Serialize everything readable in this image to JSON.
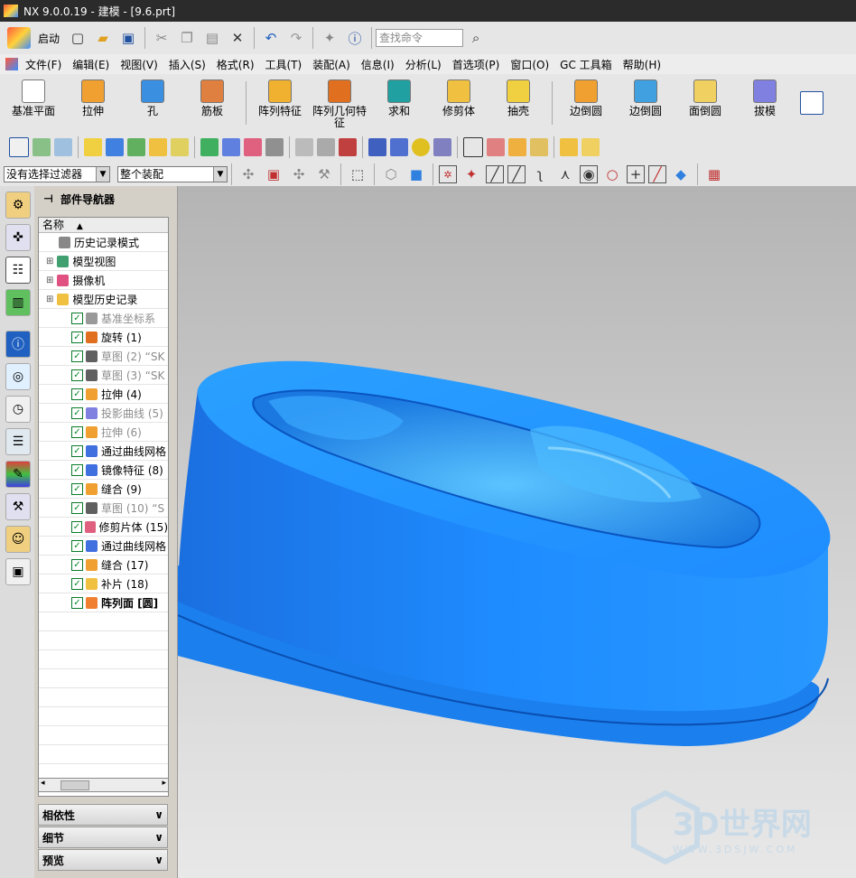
{
  "window": {
    "title": "NX 9.0.0.19 - 建模 - [9.6.prt]"
  },
  "toolbar_top": {
    "start_label": "启动",
    "search_placeholder": "查找命令"
  },
  "menubar": [
    "文件(F)",
    "编辑(E)",
    "视图(V)",
    "插入(S)",
    "格式(R)",
    "工具(T)",
    "装配(A)",
    "信息(I)",
    "分析(L)",
    "首选项(P)",
    "窗口(O)",
    "GC 工具箱",
    "帮助(H)"
  ],
  "feature_toolbar": [
    {
      "label": "基准平面",
      "icon": "datum-plane-icon",
      "color": "#ffffff"
    },
    {
      "label": "拉伸",
      "icon": "extrude-icon",
      "color": "#f0a030"
    },
    {
      "label": "孔",
      "icon": "hole-icon",
      "color": "#3b8fe0"
    },
    {
      "label": "筋板",
      "icon": "rib-icon",
      "color": "#e08040"
    },
    {
      "label": "阵列特征",
      "icon": "pattern-feature-icon",
      "color": "#f0b030"
    },
    {
      "label": "阵列几何特征",
      "icon": "pattern-geometry-icon",
      "color": "#e07020"
    },
    {
      "label": "求和",
      "icon": "unite-icon",
      "color": "#20a0a0"
    },
    {
      "label": "修剪体",
      "icon": "trim-body-icon",
      "color": "#f0c040"
    },
    {
      "label": "抽壳",
      "icon": "shell-icon",
      "color": "#f0d040"
    },
    {
      "label": "边倒圆",
      "icon": "edge-blend-icon",
      "color": "#f0a030"
    },
    {
      "label": "边倒圆",
      "icon": "edge-blend-2-icon",
      "color": "#40a0e0"
    },
    {
      "label": "面倒圆",
      "icon": "face-blend-icon",
      "color": "#f0d060"
    },
    {
      "label": "拔模",
      "icon": "draft-icon",
      "color": "#8080e0"
    }
  ],
  "selection_bar": {
    "filter": "没有选择过滤器",
    "scope": "整个装配"
  },
  "navigator": {
    "title": "部件导航器",
    "column_header": "名称",
    "items": [
      {
        "label": "历史记录模式",
        "icon": "clock-icon",
        "state": "normal",
        "checkbox": false,
        "indent": 1,
        "color": "#888888"
      },
      {
        "label": "模型视图",
        "icon": "model-views-icon",
        "state": "normal",
        "checkbox": false,
        "indent": 0,
        "color": "#40a070"
      },
      {
        "label": "摄像机",
        "icon": "camera-icon",
        "state": "normal",
        "checkbox": false,
        "indent": 0,
        "color": "#e05080"
      },
      {
        "label": "模型历史记录",
        "icon": "folder-icon",
        "state": "normal",
        "checkbox": false,
        "indent": 0,
        "color": "#f0c040"
      },
      {
        "label": "基准坐标系",
        "icon": "datum-csys-icon",
        "state": "dim",
        "checkbox": true,
        "indent": 2,
        "color": "#999999"
      },
      {
        "label": "旋转 (1)",
        "icon": "revolve-icon",
        "state": "normal",
        "checkbox": true,
        "indent": 2,
        "color": "#e07020"
      },
      {
        "label": "草图 (2) “SK",
        "icon": "sketch-icon",
        "state": "dim",
        "checkbox": true,
        "indent": 2,
        "color": "#606060"
      },
      {
        "label": "草图 (3) “SK",
        "icon": "sketch-icon",
        "state": "dim",
        "checkbox": true,
        "indent": 2,
        "color": "#606060"
      },
      {
        "label": "拉伸 (4)",
        "icon": "extrude-icon",
        "state": "normal",
        "checkbox": true,
        "indent": 2,
        "color": "#f0a030"
      },
      {
        "label": "投影曲线 (5)",
        "icon": "project-curve-icon",
        "state": "dim",
        "checkbox": true,
        "indent": 2,
        "color": "#8080e0"
      },
      {
        "label": "拉伸 (6)",
        "icon": "extrude-icon",
        "state": "dim",
        "checkbox": true,
        "indent": 2,
        "color": "#f0a030"
      },
      {
        "label": "通过曲线网格",
        "icon": "mesh-surface-icon",
        "state": "normal",
        "checkbox": true,
        "indent": 2,
        "color": "#4070e0"
      },
      {
        "label": "镜像特征 (8)",
        "icon": "mirror-icon",
        "state": "normal",
        "checkbox": true,
        "indent": 2,
        "color": "#4070e0"
      },
      {
        "label": "缝合 (9)",
        "icon": "sew-icon",
        "state": "normal",
        "checkbox": true,
        "indent": 2,
        "color": "#f0a030"
      },
      {
        "label": "草图 (10) “S",
        "icon": "sketch-icon",
        "state": "dim",
        "checkbox": true,
        "indent": 2,
        "color": "#606060"
      },
      {
        "label": "修剪片体 (15)",
        "icon": "trim-sheet-icon",
        "state": "normal",
        "checkbox": true,
        "indent": 2,
        "color": "#e06080"
      },
      {
        "label": "通过曲线网格",
        "icon": "mesh-surface-icon",
        "state": "normal",
        "checkbox": true,
        "indent": 2,
        "color": "#4070e0"
      },
      {
        "label": "缝合 (17)",
        "icon": "sew-icon",
        "state": "normal",
        "checkbox": true,
        "indent": 2,
        "color": "#f0a030"
      },
      {
        "label": "补片 (18)",
        "icon": "patch-icon",
        "state": "normal",
        "checkbox": true,
        "indent": 2,
        "color": "#f0c040"
      },
      {
        "label": "阵列面 [圆]",
        "icon": "pattern-face-icon",
        "state": "bold",
        "checkbox": true,
        "indent": 2,
        "color": "#f08030"
      }
    ],
    "panes": [
      "相依性",
      "细节",
      "预览"
    ]
  },
  "watermark": {
    "text": "3D世界网",
    "sub": "WWW.3DSJW.COM"
  },
  "colors": {
    "model_blue": "#1e8cff",
    "model_dark": "#0a5fd0",
    "background_top": "#b4b4b4",
    "background_bottom": "#e8e8e8"
  }
}
